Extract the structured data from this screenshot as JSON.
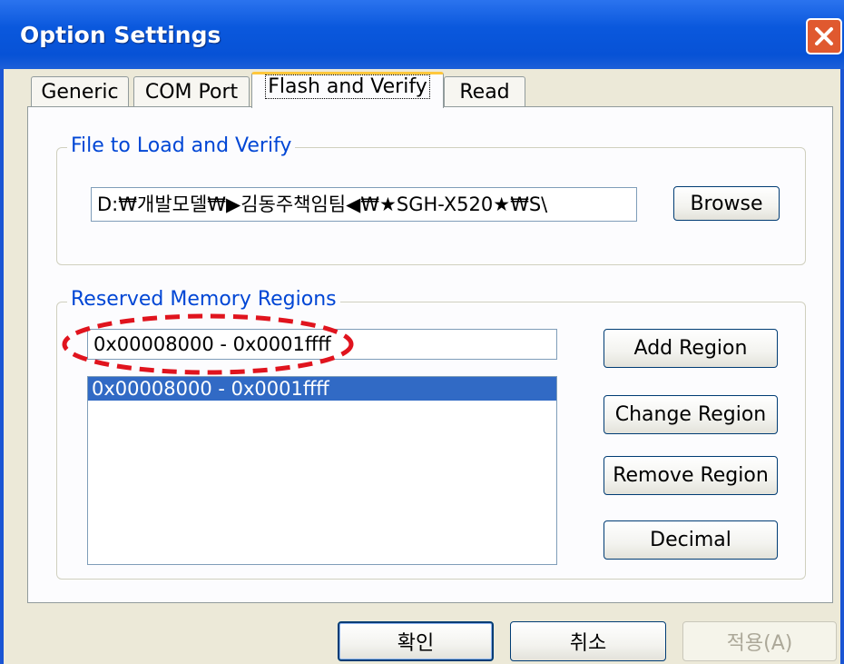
{
  "window": {
    "title": "Option Settings"
  },
  "tabs": [
    {
      "label": "Generic",
      "active": false
    },
    {
      "label": "COM Port",
      "active": false
    },
    {
      "label": "Flash and Verify",
      "active": true
    },
    {
      "label": "Read",
      "active": false
    }
  ],
  "file_group": {
    "label": "File to Load and Verify",
    "path_value": "D:₩개발모델₩▶김동주책임팀◀₩★SGH-X520★₩S\\",
    "browse_label": "Browse"
  },
  "memory_group": {
    "label": "Reserved Memory Regions",
    "region_input_value": "0x00008000 - 0x0001ffff",
    "regions": [
      "0x00008000 - 0x0001ffff"
    ],
    "add_label": "Add Region",
    "change_label": "Change Region",
    "remove_label": "Remove Region",
    "decimal_label": "Decimal"
  },
  "footer": {
    "ok_label": "확인",
    "cancel_label": "취소",
    "apply_label": "적용(A)"
  },
  "colors": {
    "titlebar": "#0a58dd",
    "group_label": "#0046d5",
    "selection": "#316ac5",
    "annotation": "#e0141e",
    "close_button": "#e0592f"
  }
}
